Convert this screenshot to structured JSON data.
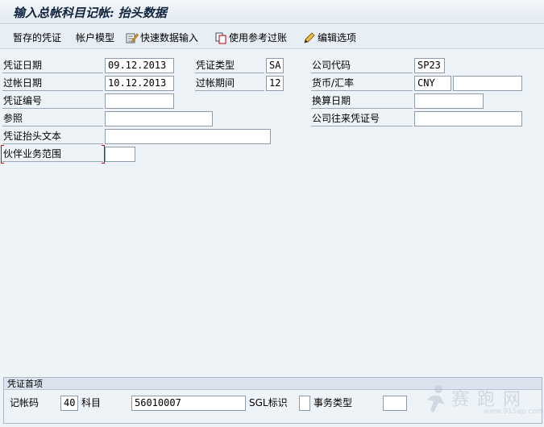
{
  "window": {
    "title": "输入总帐科目记帐: 抬头数据"
  },
  "toolbar": {
    "hold_doc": "暂存的凭证",
    "acct_model": "帐户模型",
    "fast_entry": "快速数据输入",
    "ref_post": "使用参考过账",
    "edit_options": "编辑选项"
  },
  "header": {
    "doc_date_label": "凭证日期",
    "doc_date": "09.12.2013",
    "post_date_label": "过帐日期",
    "post_date": "10.12.2013",
    "doc_no_label": "凭证编号",
    "doc_no": "",
    "reference_label": "参照",
    "reference": "",
    "header_text_label": "凭证抬头文本",
    "header_text": "",
    "partner_ba_label": "伙伴业务范围",
    "partner_ba": "",
    "doc_type_label": "凭证类型",
    "doc_type": "SA",
    "period_label": "过帐期间",
    "period": "12",
    "company_code_label": "公司代码",
    "company_code": "SP23",
    "currency_label": "货币/汇率",
    "currency": "CNY",
    "rate": "",
    "trans_date_label": "换算日期",
    "trans_date": "",
    "intercompany_label": "公司往来凭证号",
    "intercompany": ""
  },
  "first_item": {
    "group_title": "凭证首项",
    "posting_key_label": "记帐码",
    "posting_key": "40",
    "account_label": "科目",
    "account": "56010007",
    "sgl_label": "SGL标识",
    "sgl": "",
    "trans_type_label": "事务类型",
    "trans_type": ""
  },
  "watermark": {
    "text": "赛跑网",
    "url": "www.915ap.com"
  }
}
